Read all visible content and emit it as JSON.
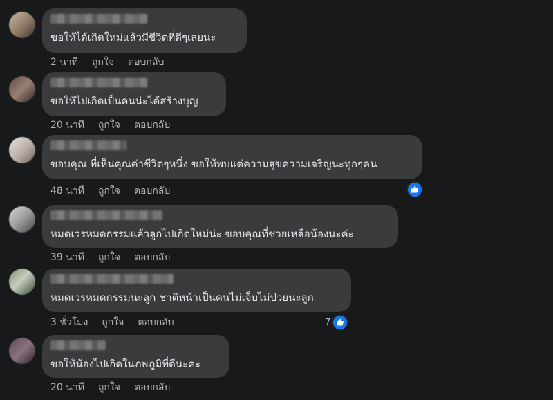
{
  "colors": {
    "background": "#18191a",
    "bubble": "#3a3b3c",
    "text": "#e4e6eb",
    "meta": "#b0b3b8",
    "like_blue": "#1877f2"
  },
  "comments": [
    {
      "text": "ขอให้ได้เกิดใหม่แล้วมีชีวิตที่ดีๆเลยนะ",
      "time": "2 นาที",
      "like_label": "ถูกใจ",
      "reply_label": "ตอบกลับ",
      "reactions": null
    },
    {
      "text": "ขอให้ไปเกิดเป็นคนน่ะได้สร้างบุญ",
      "time": "20 นาที",
      "like_label": "ถูกใจ",
      "reply_label": "ตอบกลับ",
      "reactions": null
    },
    {
      "text": "ขอบคุณ ที่เห็นคุณค่าชีวิตๆหนึ่ง ขอให้พบแต่ความสุขความเจริญนะทุกๆคน",
      "time": "48 นาที",
      "like_label": "ถูกใจ",
      "reply_label": "ตอบกลับ",
      "reactions": {
        "icon": "like-icon",
        "count": ""
      }
    },
    {
      "text": "หมดเวรหมดกรรมแล้วลูกไปเกิดใหม่น่ะ ขอบคุณที่ช่วยเหลือน้องนะค่ะ",
      "time": "39 นาที",
      "like_label": "ถูกใจ",
      "reply_label": "ตอบกลับ",
      "reactions": null
    },
    {
      "text": "หมดเวรหมดกรรมนะลูก ชาติหน้าเป็นคนไม่เจ็บไม่ป่วยนะลูก",
      "time": "3 ชั่วโมง",
      "like_label": "ถูกใจ",
      "reply_label": "ตอบกลับ",
      "reactions": {
        "icon": "like-icon",
        "count": "7"
      }
    },
    {
      "text": "ขอให้น้องไปเกิดในภพภูมิที่ดีนะคะ",
      "time": "20 นาที",
      "like_label": "ถูกใจ",
      "reply_label": "ตอบกลับ",
      "reactions": null
    }
  ]
}
